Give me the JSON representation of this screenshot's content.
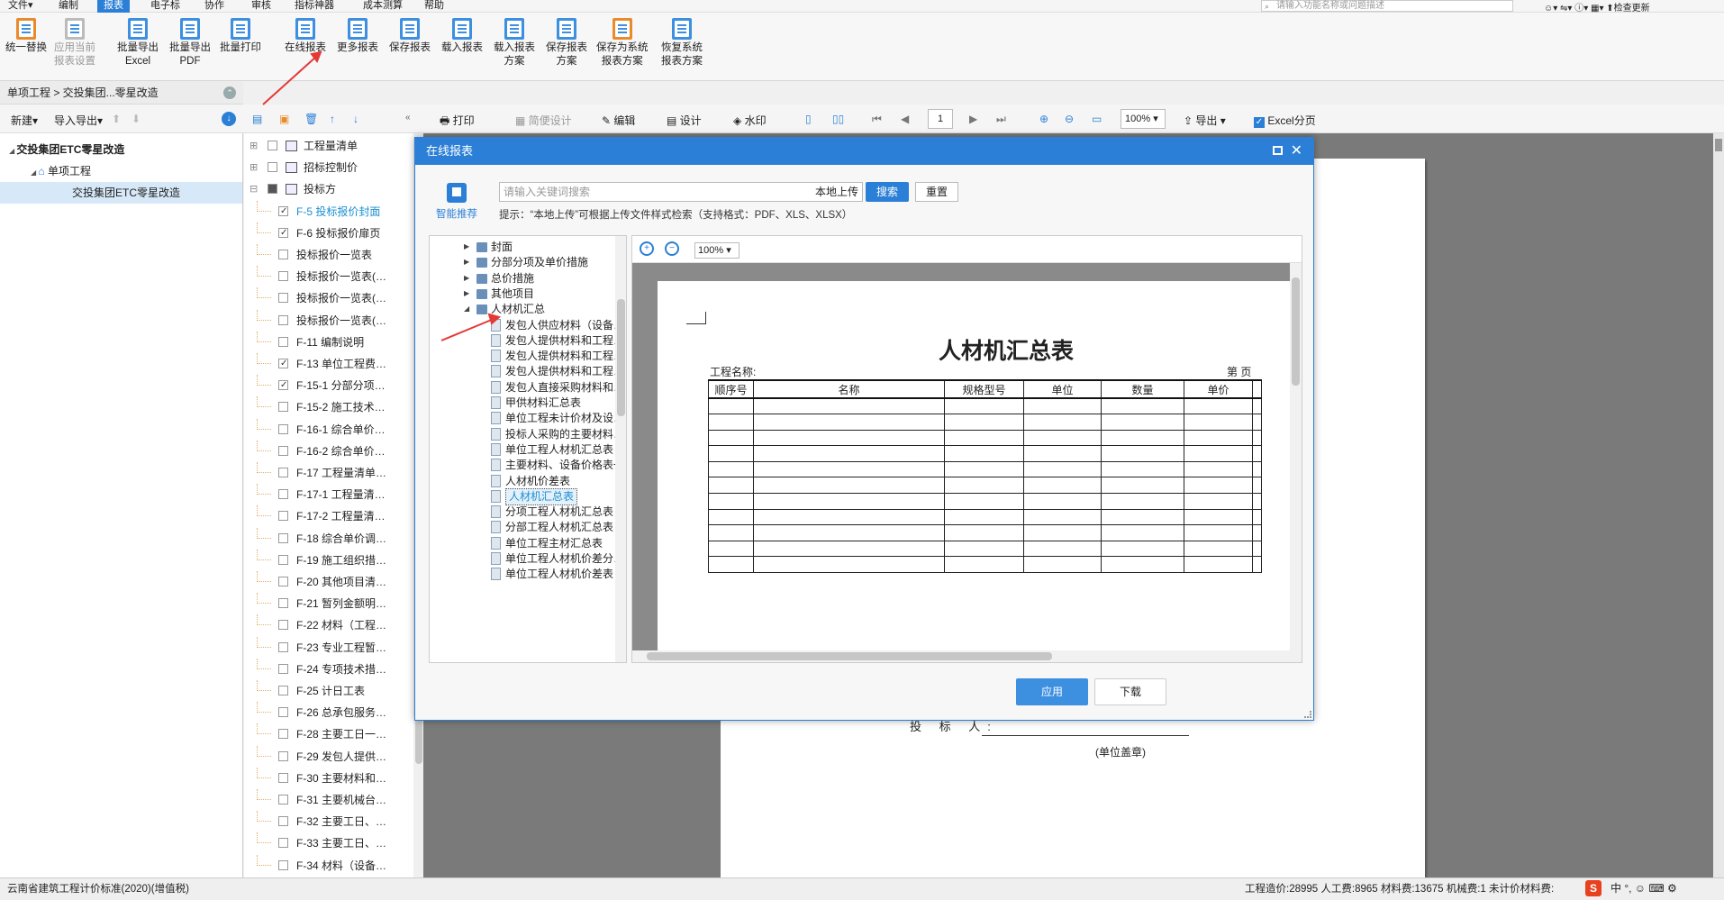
{
  "menubar": {
    "items": [
      "文件▾",
      "编制",
      "报表",
      "电子标",
      "协作",
      "审核",
      "指标神器",
      "成本测算",
      "帮助"
    ],
    "active_index": 2,
    "search_placeholder": "请输入功能名称或问题描述",
    "right": {
      "check_update": "检查更新"
    }
  },
  "ribbon": {
    "buttons": [
      {
        "line1": "统一替换",
        "line2": "",
        "enabled": true
      },
      {
        "line1": "应用当前",
        "line2": "报表设置",
        "enabled": false
      },
      {
        "line1": "批量导出",
        "line2": "Excel",
        "enabled": true
      },
      {
        "line1": "批量导出",
        "line2": "PDF",
        "enabled": true
      },
      {
        "line1": "批量打印",
        "line2": "",
        "enabled": true
      },
      {
        "line1": "在线报表",
        "line2": "",
        "enabled": true
      },
      {
        "line1": "更多报表",
        "line2": "",
        "enabled": true
      },
      {
        "line1": "保存报表",
        "line2": "",
        "enabled": true
      },
      {
        "line1": "载入报表",
        "line2": "",
        "enabled": true
      },
      {
        "line1": "载入报表",
        "line2": "方案",
        "enabled": true
      },
      {
        "line1": "保存报表",
        "line2": "方案",
        "enabled": true
      },
      {
        "line1": "保存为系统",
        "line2": "报表方案",
        "enabled": true
      },
      {
        "line1": "恢复系统",
        "line2": "报表方案",
        "enabled": true
      }
    ]
  },
  "breadcrumb": "单项工程 > 交投集团...零星改造",
  "left_toolbar": {
    "new": "新建▾",
    "import_export": "导入导出▾"
  },
  "project_tree": [
    {
      "label": "交投集团ETC零星改造",
      "level": 0
    },
    {
      "label": "单项工程",
      "level": 1
    },
    {
      "label": "交投集团ETC零星改造",
      "level": 2,
      "selected": true
    }
  ],
  "report_list": [
    {
      "label": "工程量清单",
      "kind": "group",
      "checked": false
    },
    {
      "label": "招标控制价",
      "kind": "group",
      "checked": false
    },
    {
      "label": "投标方",
      "kind": "group",
      "checked": true
    },
    {
      "label": "F-5  投标报价封面",
      "checked": true,
      "highlight": true
    },
    {
      "label": "F-6  投标报价扉页",
      "checked": true
    },
    {
      "label": "投标报价一览表",
      "checked": false
    },
    {
      "label": "投标报价一览表(…",
      "checked": false
    },
    {
      "label": "投标报价一览表(…",
      "checked": false
    },
    {
      "label": "投标报价一览表(…",
      "checked": false
    },
    {
      "label": "F-11  编制说明",
      "checked": false
    },
    {
      "label": "F-13  单位工程费…",
      "checked": true
    },
    {
      "label": "F-15-1  分部分项…",
      "checked": true
    },
    {
      "label": "F-15-2  施工技术…",
      "checked": false
    },
    {
      "label": "F-16-1  综合单价…",
      "checked": false
    },
    {
      "label": "F-16-2  综合单价…",
      "checked": false
    },
    {
      "label": "F-17  工程量清单…",
      "checked": false
    },
    {
      "label": "F-17-1  工程量清…",
      "checked": false
    },
    {
      "label": "F-17-2  工程量清…",
      "checked": false
    },
    {
      "label": "F-18  综合单价调…",
      "checked": false
    },
    {
      "label": "F-19  施工组织措…",
      "checked": false
    },
    {
      "label": "F-20  其他项目清…",
      "checked": false
    },
    {
      "label": "F-21  暂列金额明…",
      "checked": false
    },
    {
      "label": "F-22  材料（工程…",
      "checked": false
    },
    {
      "label": "F-23  专业工程暂…",
      "checked": false
    },
    {
      "label": "F-24  专项技术措…",
      "checked": false
    },
    {
      "label": "F-25  计日工表",
      "checked": false
    },
    {
      "label": "F-26  总承包服务…",
      "checked": false
    },
    {
      "label": "F-28  主要工日一…",
      "checked": false
    },
    {
      "label": "F-29  发包人提供…",
      "checked": false
    },
    {
      "label": "F-30  主要材料和…",
      "checked": false
    },
    {
      "label": "F-31  主要机械台…",
      "checked": false
    },
    {
      "label": "F-32  主要工日、…",
      "checked": false
    },
    {
      "label": "F-33  主要工日、…",
      "checked": false
    },
    {
      "label": "F-34  材料（设备…",
      "checked": false
    }
  ],
  "preview_toolbar": {
    "print": "打印",
    "simple_design": "简便设计",
    "edit": "编辑",
    "design": "设计",
    "watermark": "水印",
    "page": "1",
    "zoom": "100%",
    "export": "导出",
    "excel_paging": "Excel分页",
    "excel_paging_checked": true
  },
  "background_page": {
    "bidder_label": "投  标  人:",
    "seal_label": "(单位盖章)"
  },
  "dialog": {
    "title": "在线报表",
    "smart_recommend": "智能推荐",
    "search_placeholder": "请输入关键词搜索",
    "local_upload": "本地上传",
    "search_btn": "搜索",
    "reset_btn": "重置",
    "hint": "提示：“本地上传”可根据上传文件样式检索（支持格式：PDF、XLS、XLSX）",
    "tree": [
      {
        "label": "封面",
        "type": "folder",
        "level": 0
      },
      {
        "label": "分部分项及单价措施",
        "type": "folder",
        "level": 0
      },
      {
        "label": "总价措施",
        "type": "folder",
        "level": 0
      },
      {
        "label": "其他项目",
        "type": "folder",
        "level": 0
      },
      {
        "label": "人材机汇总",
        "type": "folder",
        "level": 0,
        "expanded": true
      },
      {
        "label": "发包人供应材料（设备…",
        "type": "doc",
        "level": 1
      },
      {
        "label": "发包人提供材料和工程…",
        "type": "doc",
        "level": 1
      },
      {
        "label": "发包人提供材料和工程…",
        "type": "doc",
        "level": 1
      },
      {
        "label": "发包人提供材料和工程…",
        "type": "doc",
        "level": 1
      },
      {
        "label": "发包人直接采购材料和…",
        "type": "doc",
        "level": 1
      },
      {
        "label": "甲供材料汇总表",
        "type": "doc",
        "level": 1
      },
      {
        "label": "单位工程未计价材及设…",
        "type": "doc",
        "level": 1
      },
      {
        "label": "投标人采购的主要材料…",
        "type": "doc",
        "level": 1
      },
      {
        "label": "单位工程人材机汇总表",
        "type": "doc",
        "level": 1
      },
      {
        "label": "主要材料、设备价格表一",
        "type": "doc",
        "level": 1
      },
      {
        "label": "人材机价差表",
        "type": "doc",
        "level": 1
      },
      {
        "label": "人材机汇总表",
        "type": "doc",
        "level": 1,
        "selected": true
      },
      {
        "label": "分项工程人材机汇总表",
        "type": "doc",
        "level": 1
      },
      {
        "label": "分部工程人材机汇总表",
        "type": "doc",
        "level": 1
      },
      {
        "label": "单位工程主材汇总表",
        "type": "doc",
        "level": 1
      },
      {
        "label": "单位工程人材机价差分…",
        "type": "doc",
        "level": 1
      },
      {
        "label": "单位工程人材机价差表",
        "type": "doc",
        "level": 1
      }
    ],
    "preview": {
      "zoom": "100%",
      "title": "人材机汇总表",
      "project_name_label": "工程名称:",
      "page_label": "第    页",
      "columns": [
        "顺序号",
        "名称",
        "规格型号",
        "单位",
        "数量",
        "单价",
        ""
      ],
      "empty_rows": 11
    },
    "apply": "应用",
    "download": "下载"
  },
  "statusbar": {
    "standard": "云南省建筑工程计价标准(2020)(增值税)",
    "summary": "工程造价:28995   人工费:8965   材料费:13675   机械费:1   未计价材料费:"
  },
  "ime": {
    "logo": "S",
    "text": "中  °,  ☺  ⌨  ⚙"
  }
}
